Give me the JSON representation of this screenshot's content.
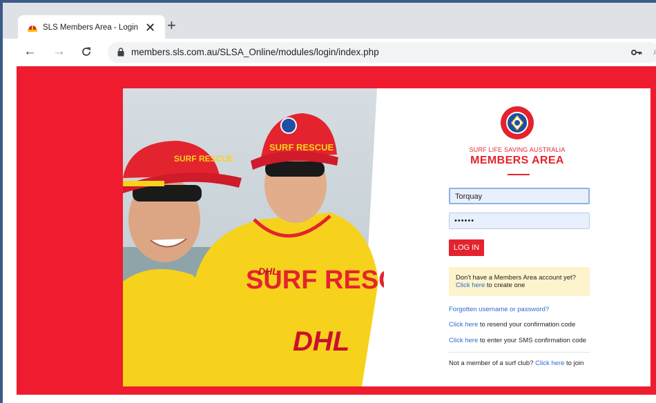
{
  "browser": {
    "tab_title": "SLS Members Area - Login",
    "tab_close": "✕",
    "new_tab": "+",
    "back": "←",
    "forward": "→",
    "reload": "C",
    "url_host": "members.sls.com.au",
    "url_path": "/SLSA_Online/modules/login/index.php"
  },
  "login": {
    "org_name": "SURF LIFE SAVING AUSTRALIA",
    "area_title": "MEMBERS AREA",
    "username_value": "Torquay",
    "password_value": "••••••",
    "login_button": "LOG IN",
    "signup_prompt": "Don't have a Members Area account yet?",
    "signup_link": "Click here",
    "signup_suffix": " to create one",
    "forgot_link": "Forgotten username or password?",
    "resend_link": "Click here",
    "resend_suffix": " to resend your confirmation code",
    "sms_link": "Click here",
    "sms_suffix": " to enter your SMS confirmation code",
    "join_prefix": "Not a member of a surf club? ",
    "join_link": "Click here",
    "join_suffix": " to join"
  },
  "photo": {
    "cap_text": "SURF RESCUE",
    "shirt_brand": "DHL",
    "shirt_text": "SURF RESCU"
  },
  "colors": {
    "brand_red": "#e3242e",
    "page_red": "#ee1c2e",
    "link_blue": "#2a6bd0",
    "notice_yellow": "#fdf3cc"
  }
}
